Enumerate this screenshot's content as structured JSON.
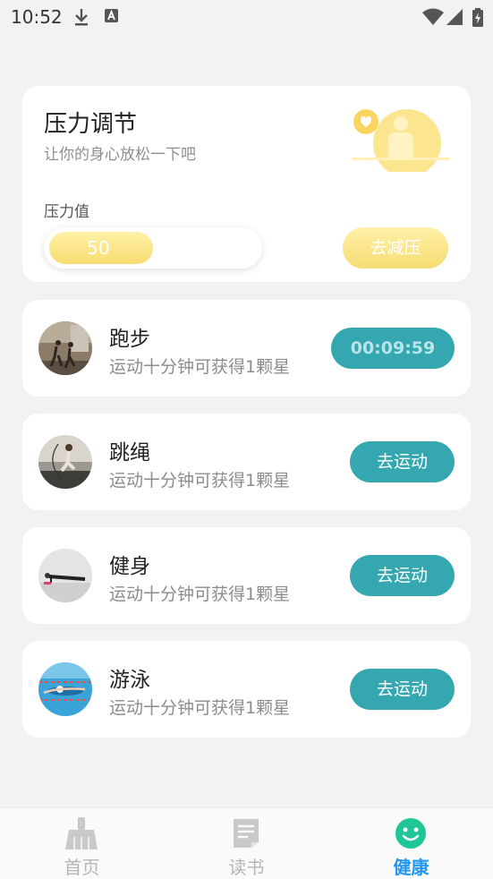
{
  "status_bar": {
    "time": "10:52"
  },
  "stress": {
    "title": "压力调节",
    "subtitle": "让你的身心放松一下吧",
    "label": "压力值",
    "value": "50",
    "level_fraction": 0.5,
    "button": "去减压"
  },
  "sports": [
    {
      "name": "跑步",
      "desc": "运动十分钟可获得1颗星",
      "button": "00:09:59"
    },
    {
      "name": "跳绳",
      "desc": "运动十分钟可获得1颗星",
      "button": "去运动"
    },
    {
      "name": "健身",
      "desc": "运动十分钟可获得1颗星",
      "button": "去运动"
    },
    {
      "name": "游泳",
      "desc": "运动十分钟可获得1颗星",
      "button": "去运动"
    }
  ],
  "tabs": [
    {
      "label": "首页",
      "icon": "broom-icon"
    },
    {
      "label": "读书",
      "icon": "document-icon"
    },
    {
      "label": "健康",
      "icon": "smile-icon"
    }
  ],
  "colors": {
    "accent": "#35a7b1",
    "yellow": "#f7dc72",
    "tab_active": "#2196f3"
  }
}
